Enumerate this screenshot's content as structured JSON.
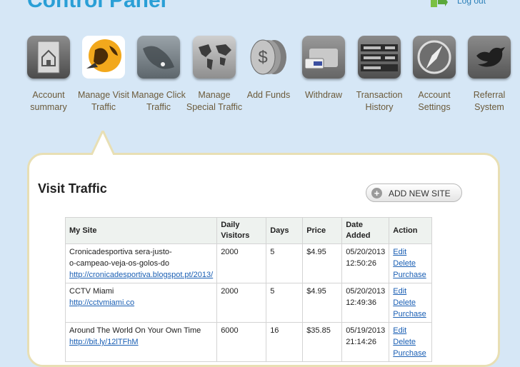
{
  "header": {
    "title": "Control Panel",
    "logout_label": "Log out"
  },
  "nav": {
    "items": [
      {
        "label": "Account summary",
        "icon": "home-icon"
      },
      {
        "label": "Manage Visit Traffic",
        "icon": "globe-icon"
      },
      {
        "label": "Manage Click Traffic",
        "icon": "map-icon"
      },
      {
        "label": "Manage Special Traffic",
        "icon": "world-map-icon"
      },
      {
        "label": "Add Funds",
        "icon": "coins-icon"
      },
      {
        "label": "Withdraw",
        "icon": "wallet-icon"
      },
      {
        "label": "Transaction History",
        "icon": "ledger-icon"
      },
      {
        "label": "Account Settings",
        "icon": "compass-icon"
      },
      {
        "label": "Referral System",
        "icon": "bird-icon"
      }
    ],
    "active": "Manage Visit Traffic"
  },
  "panel": {
    "title": "Visit Traffic",
    "add_button_label": "ADD NEW SITE"
  },
  "table": {
    "headers": {
      "site": "My Site",
      "daily_line1": "Daily",
      "daily_line2": "Visitors",
      "days": "Days",
      "price": "Price",
      "date_line1": "Date",
      "date_line2": "Added",
      "action": "Action"
    },
    "rows": [
      {
        "name_line1": "Cronicadesportiva sera-justo-",
        "name_line2": "o-campeao-veja-os-golos-do",
        "url": "http://cronicadesportiva.blogspot.pt/2013/",
        "daily": "2000",
        "days": "5",
        "price": "$4.95",
        "date": "05/20/2013",
        "time": "12:50:26",
        "edit": "Edit",
        "delete": "Delete",
        "purchase": "Purchase"
      },
      {
        "name_line1": "CCTV Miami",
        "name_line2": "",
        "url": "http://cctvmiami.co",
        "daily": "2000",
        "days": "5",
        "price": "$4.95",
        "date": "05/20/2013",
        "time": "12:49:36",
        "edit": "Edit",
        "delete": "Delete",
        "purchase": "Purchase"
      },
      {
        "name_line1": "Around The World On Your Own Time",
        "name_line2": "",
        "url": "http://bit.ly/12lTFhM",
        "daily": "6000",
        "days": "16",
        "price": "$35.85",
        "date": "05/19/2013",
        "time": "21:14:26",
        "edit": "Edit",
        "delete": "Delete",
        "purchase": "Purchase"
      }
    ]
  },
  "colors": {
    "background": "#d6e7f6",
    "title": "#2a9fd6",
    "nav_label": "#6b5a3a",
    "link": "#1a5fb4",
    "panel_border": "#e8dfb4"
  }
}
